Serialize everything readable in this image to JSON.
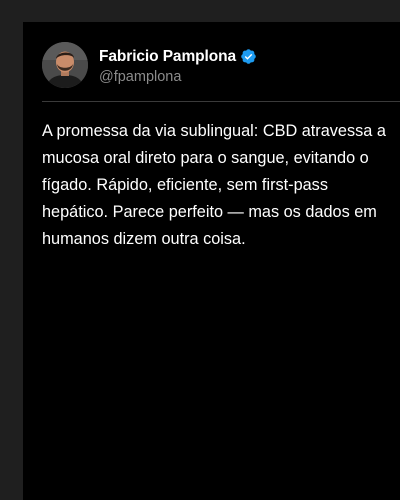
{
  "tweet": {
    "author": {
      "name": "Fabricio Pamplona",
      "handle": "@fpamplona",
      "verified": true,
      "avatar": "author-avatar-photo"
    },
    "text_lines": [
      "A promessa da via sublingual: CBD atravessa a",
      "mucosa oral direto para o sangue, evitando o",
      "fígado. Rápido, eficiente, sem first-pass",
      "hepático. Parece perfeito — mas os dados em",
      "humanos dizem outra coisa."
    ]
  },
  "colors": {
    "page_background": "#1f1f1f",
    "card_background": "#000000",
    "text_primary": "#ffffff",
    "text_secondary": "#8b8b8b",
    "verified_badge": "#1d9bf0",
    "divider": "#3a3a3a"
  },
  "icons": {
    "verified": "verified-badge-icon"
  }
}
